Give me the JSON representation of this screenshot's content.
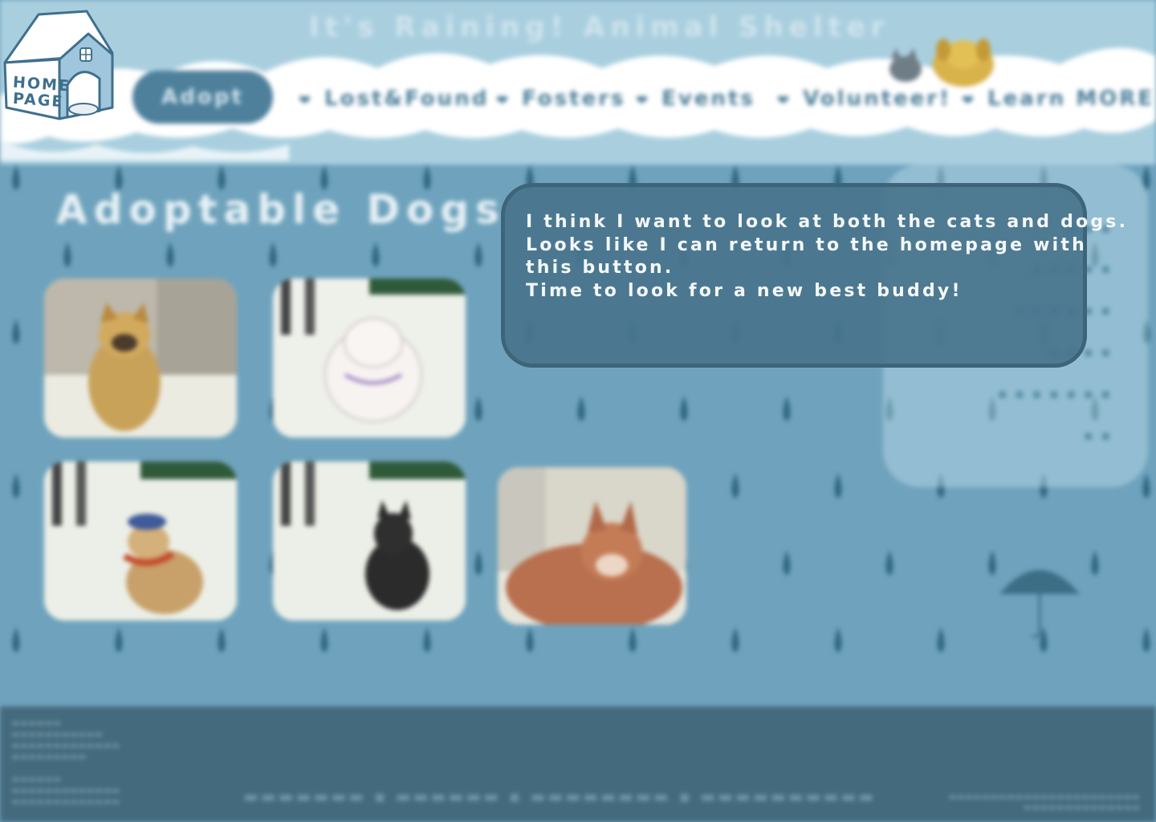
{
  "site": {
    "title": "It's Raining! Animal Shelter"
  },
  "home_button": {
    "line1": "HOME",
    "line2": "PAGE"
  },
  "nav": {
    "adopt": "Adopt",
    "items": [
      "Lost&Found",
      "Fosters",
      "Events",
      "Volunteer!",
      "Learn MORE"
    ]
  },
  "page": {
    "heading": "Adoptable Dogs"
  },
  "dogs": [
    {
      "name": "dog-brown-pug"
    },
    {
      "name": "dog-white-fluffy"
    },
    {
      "name": "dog-beret-scarf"
    },
    {
      "name": "dog-black"
    },
    {
      "name": "dog-shiba"
    }
  ],
  "dialog": {
    "lines": [
      "I think I want to look at both the cats and dogs.",
      "Looks like I can return to the homepage with",
      "this button.",
      "Time to look for a new best buddy!"
    ]
  },
  "colors": {
    "rain_bg": "#6fa3bd",
    "sky": "#a9cfdf",
    "footer": "#446a7d",
    "dialog_bg": "#48748c",
    "dialog_border": "#3d6478"
  }
}
